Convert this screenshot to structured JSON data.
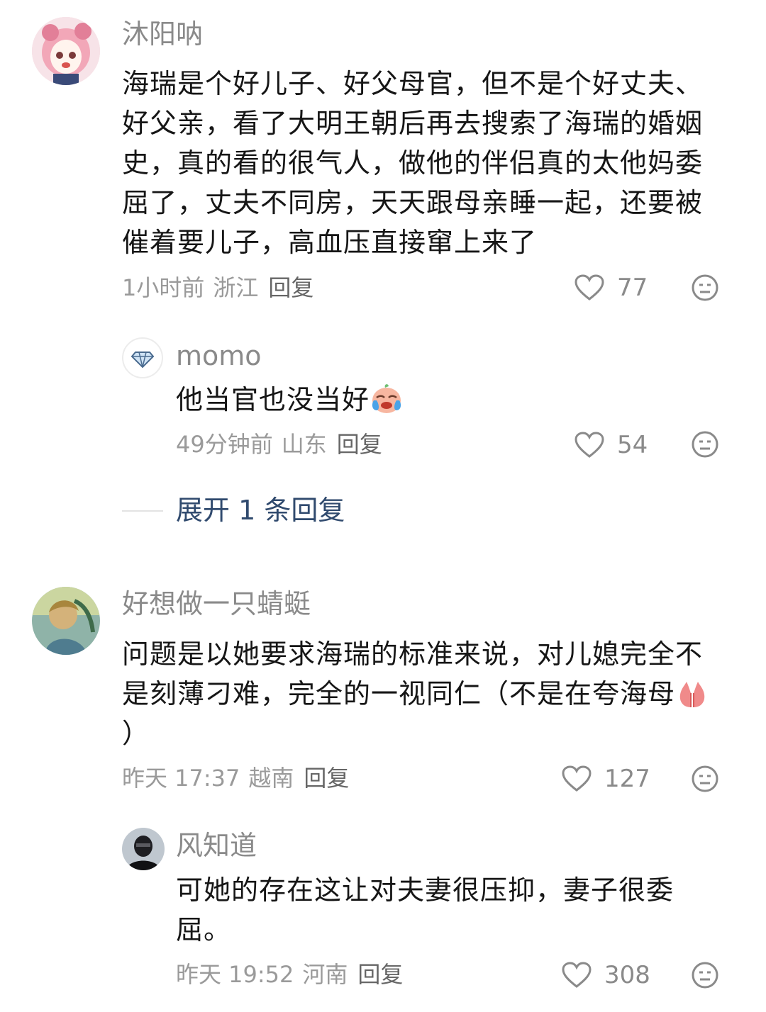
{
  "comments": [
    {
      "name": "沐阳呐",
      "text": "海瑞是个好儿子、好父母官，但不是个好丈夫、好父亲，看了大明王朝后再去搜索了海瑞的婚姻史，真的看的很气人，做他的伴侣真的太他妈委屈了，丈夫不同房，天天跟母亲睡一起，还要被催着要儿子，高血压直接窜上来了",
      "time": "1小时前",
      "location": "浙江",
      "reply": "回复",
      "likes": "77",
      "avatar_icon": "anime-girl-avatar",
      "replies": [
        {
          "name": "momo",
          "text": "他当官也没当好",
          "emoji": "crying-face-emoji",
          "time": "49分钟前",
          "location": "山东",
          "reply": "回复",
          "likes": "54",
          "avatar_icon": "diamond-icon"
        }
      ],
      "expand_label": "展开 1 条回复"
    },
    {
      "name": "好想做一只蜻蜓",
      "text": "问题是以她要求海瑞的标准来说，对儿媳完全不是刻薄刁难，完全的一视同仁（不是在夸海母",
      "text_tail": "）",
      "emoji": "pressed-hands-emoji",
      "time": "昨天 17:37",
      "location": "越南",
      "reply": "回复",
      "likes": "127",
      "avatar_icon": "painting-avatar",
      "replies": [
        {
          "name": "风知道",
          "text": "可她的存在这让对夫妻很压抑，妻子很委屈。",
          "time": "昨天 19:52",
          "location": "河南",
          "reply": "回复",
          "likes": "308",
          "avatar_icon": "masked-person-avatar"
        }
      ]
    }
  ],
  "colors": {
    "text": "#161616",
    "name": "#8a8a8a",
    "meta": "#9a9a9a",
    "expand": "#304a6e"
  }
}
